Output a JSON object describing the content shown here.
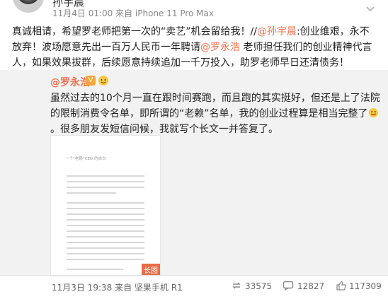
{
  "post": {
    "author": "孙宇晨",
    "meta": "11月4日 01:00 来自 iPhone 11 Pro Max",
    "text_before_link": "真诚相请，希望罗老师把第一次的“卖艺”机会留给我！//",
    "mention_self": "@孙宇晨",
    "text_mid": ":创业维艰，永不放弃！波场愿意先出一百万人民币一年聘请",
    "mention_luo": "@罗永浩",
    "text_after": " 老师担任我们的创业精神代言人，如果效果拔群，后续愿意持续追加一千万投入，助罗老师早日还清债务！"
  },
  "repost": {
    "author": "@罗永浩",
    "text": "虽然过去的10个月一直在跟时间赛跑，而且跑的其实挺好，但还是上了法院的限制消费令名单，即所谓的“老赖”名单，我的创业过程算是相当完整了",
    "text_tail": "。很多朋友发短信问候，我就写个长文一并答复了。",
    "image_title": "一个“老赖”CEO 的自白",
    "image_tag": "长图",
    "meta": "11月3日 19:38 来自 坚果手机 R1",
    "reposts": "33575",
    "comments": "12827",
    "likes": "117309"
  },
  "colors": {
    "link": "#eb7350",
    "tag": "#e86c46"
  }
}
